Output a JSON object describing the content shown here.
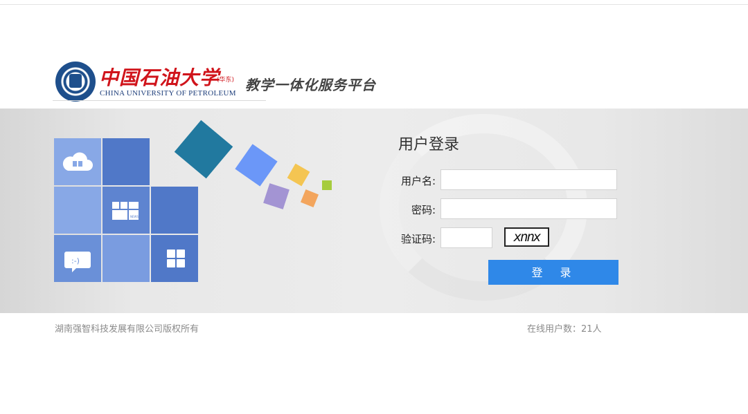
{
  "header": {
    "logo_cn": "中国石油大学",
    "logo_tag": "(华东)",
    "logo_en": "CHINA UNIVERSITY OF PETROLEUM",
    "platform_title": "教学一体化服务平台"
  },
  "tiles": {
    "news_label": "NEWS",
    "chat_text": ":-)"
  },
  "login": {
    "title": "用户登录",
    "username_label": "用户名:",
    "username_value": "",
    "password_label": "密码:",
    "password_value": "",
    "captcha_label": "验证码:",
    "captcha_value": "",
    "captcha_image_text": "xnnx",
    "submit_label": "登 录"
  },
  "footer": {
    "copyright": "湖南强智科技发展有限公司版权所有",
    "online_users": "在线用户数：21人"
  },
  "colors": {
    "accent": "#2f88e8",
    "brand_red": "#d0141b",
    "tile_blue": "#5078c8"
  }
}
